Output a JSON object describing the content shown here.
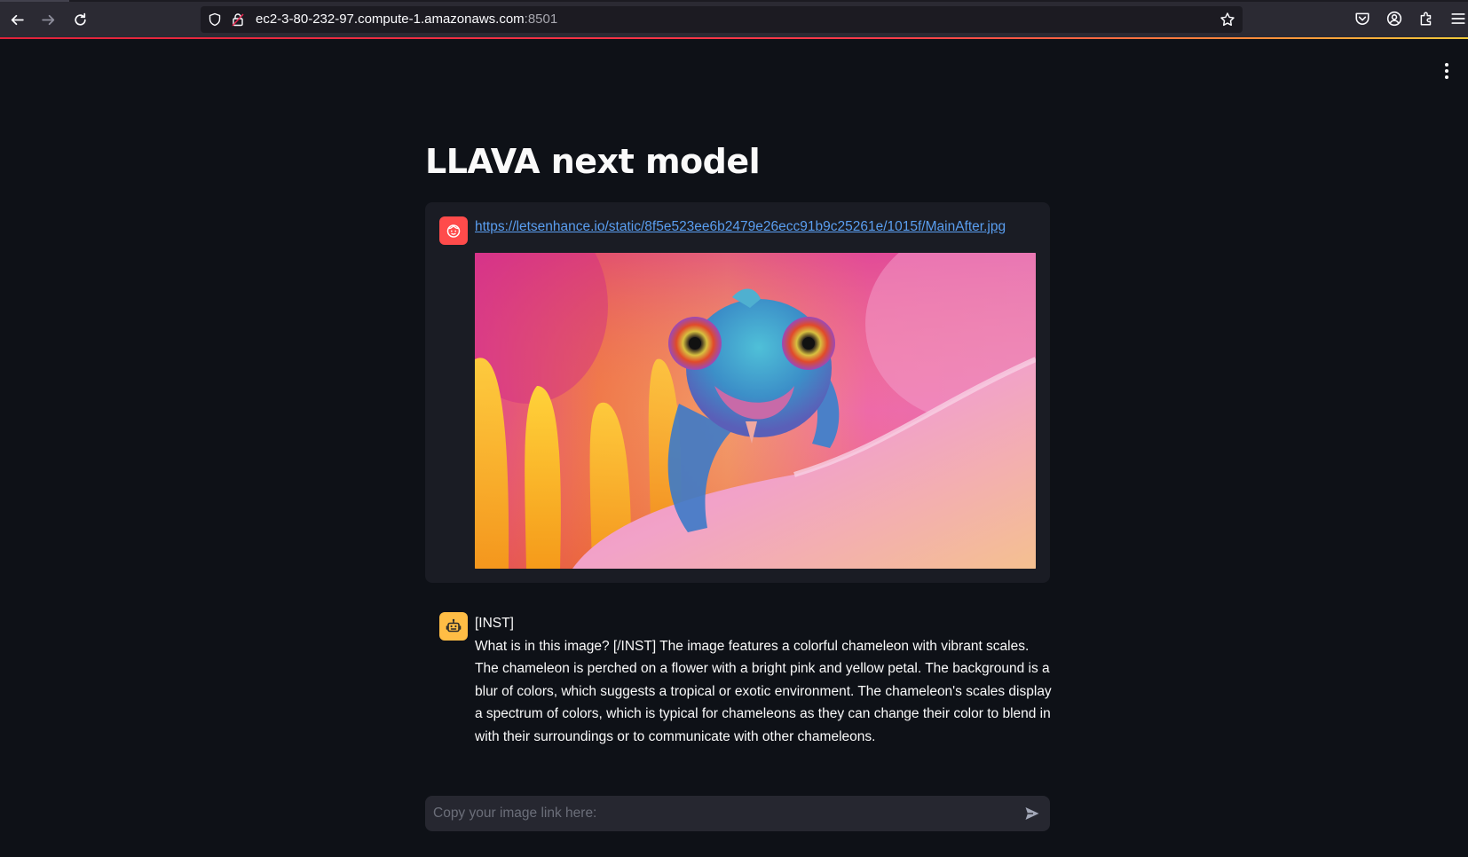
{
  "browser": {
    "url_host": "ec2-3-80-232-97.compute-1.amazonaws.com",
    "url_port": ":8501"
  },
  "app": {
    "title": "LLAVA next model"
  },
  "messages": [
    {
      "role": "user",
      "avatar_icon": "user-face-icon",
      "link": "https://letsenhance.io/static/8f5e523ee6b2479e26ecc91b9c25261e/1015f/MainAfter.jpg",
      "image_subject": "chameleon-on-flower"
    },
    {
      "role": "assistant",
      "avatar_icon": "robot-icon",
      "line1": "[INST]",
      "line2": "What is in this image? [/INST] The image features a colorful chameleon with vibrant scales. The chameleon is perched on a flower with a bright pink and yellow petal. The background is a blur of colors, which suggests a tropical or exotic environment. The chameleon's scales display a spectrum of colors, which is typical for chameleons as they can change their color to blend in with their surroundings or to communicate with other chameleons."
    }
  ],
  "chat_input": {
    "placeholder": "Copy your image link here:",
    "value": ""
  },
  "colors": {
    "background": "#0e1117",
    "user_avatar": "#ff4b4b",
    "assistant_avatar": "#ffbd45",
    "link": "#5a9ef0",
    "message_bg": "#1a1c24",
    "input_bg": "#262730"
  }
}
